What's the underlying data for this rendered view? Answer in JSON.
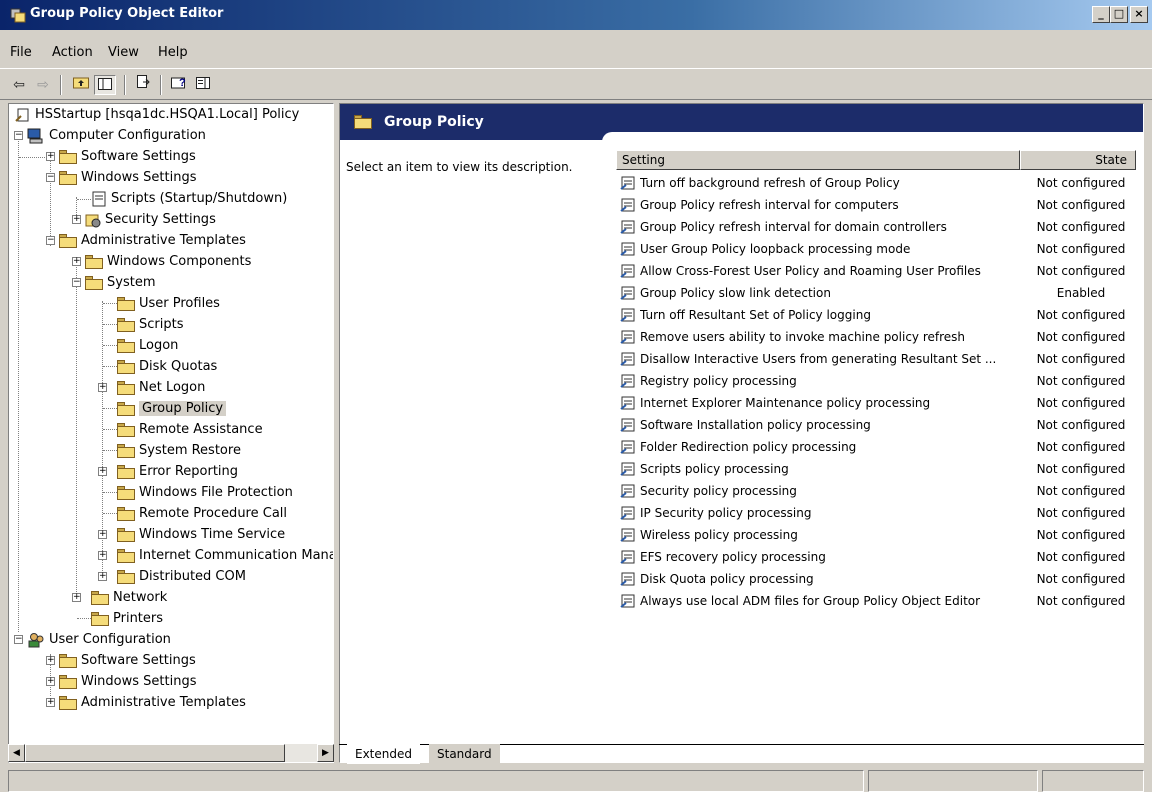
{
  "window": {
    "title": "Group Policy Object Editor",
    "buttons": [
      "_",
      "□",
      "×"
    ]
  },
  "menu": {
    "items": [
      "File",
      "Action",
      "View",
      "Help"
    ]
  },
  "toolbar": {
    "icons": [
      "back-arrow-icon",
      "forward-arrow-icon",
      "up-folder-icon",
      "show-hide-tree-icon",
      "export-list-icon",
      "help-icon",
      "properties-icon"
    ]
  },
  "tree": {
    "items": [
      {
        "label": "HSStartup [hsqa1dc.HSQA1.Local] Policy"
      },
      {
        "label": "Computer Configuration"
      },
      {
        "label": "Software Settings"
      },
      {
        "label": "Windows Settings"
      },
      {
        "label": "Scripts (Startup/Shutdown)"
      },
      {
        "label": "Security Settings"
      },
      {
        "label": "Administrative Templates"
      },
      {
        "label": "Windows Components"
      },
      {
        "label": "System"
      },
      {
        "label": "User Profiles"
      },
      {
        "label": "Scripts"
      },
      {
        "label": "Logon"
      },
      {
        "label": "Disk Quotas"
      },
      {
        "label": "Net Logon"
      },
      {
        "label": "Group Policy"
      },
      {
        "label": "Remote Assistance"
      },
      {
        "label": "System Restore"
      },
      {
        "label": "Error Reporting"
      },
      {
        "label": "Windows File Protection"
      },
      {
        "label": "Remote Procedure Call"
      },
      {
        "label": "Windows Time Service"
      },
      {
        "label": "Internet Communication Mana"
      },
      {
        "label": "Distributed COM"
      },
      {
        "label": "Network"
      },
      {
        "label": "Printers"
      },
      {
        "label": "User Configuration"
      },
      {
        "label": "Software Settings"
      },
      {
        "label": "Windows Settings"
      },
      {
        "label": "Administrative Templates"
      }
    ]
  },
  "details": {
    "header_title": "Group Policy",
    "description": "Select an item to view its description.",
    "columns": {
      "setting": "Setting",
      "state": "State"
    },
    "rows": [
      {
        "setting": "Turn off background refresh of Group Policy",
        "state": "Not configured"
      },
      {
        "setting": "Group Policy refresh interval for computers",
        "state": "Not configured"
      },
      {
        "setting": "Group Policy refresh interval for domain controllers",
        "state": "Not configured"
      },
      {
        "setting": "User Group Policy loopback processing mode",
        "state": "Not configured"
      },
      {
        "setting": "Allow Cross-Forest User Policy and Roaming User Profiles",
        "state": "Not configured"
      },
      {
        "setting": "Group Policy slow link detection",
        "state": "Enabled"
      },
      {
        "setting": "Turn off Resultant Set of Policy logging",
        "state": "Not configured"
      },
      {
        "setting": "Remove users ability to invoke machine policy refresh",
        "state": "Not configured"
      },
      {
        "setting": "Disallow Interactive Users from generating Resultant Set ...",
        "state": "Not configured"
      },
      {
        "setting": "Registry policy processing",
        "state": "Not configured"
      },
      {
        "setting": "Internet Explorer Maintenance policy processing",
        "state": "Not configured"
      },
      {
        "setting": "Software Installation policy processing",
        "state": "Not configured"
      },
      {
        "setting": "Folder Redirection policy processing",
        "state": "Not configured"
      },
      {
        "setting": "Scripts policy processing",
        "state": "Not configured"
      },
      {
        "setting": "Security policy processing",
        "state": "Not configured"
      },
      {
        "setting": "IP Security policy processing",
        "state": "Not configured"
      },
      {
        "setting": "Wireless policy processing",
        "state": "Not configured"
      },
      {
        "setting": "EFS recovery policy processing",
        "state": "Not configured"
      },
      {
        "setting": "Disk Quota policy processing",
        "state": "Not configured"
      },
      {
        "setting": "Always use local ADM files for Group Policy Object Editor",
        "state": "Not configured"
      }
    ]
  },
  "tabs": [
    {
      "label": "Extended"
    },
    {
      "label": "Standard"
    }
  ]
}
